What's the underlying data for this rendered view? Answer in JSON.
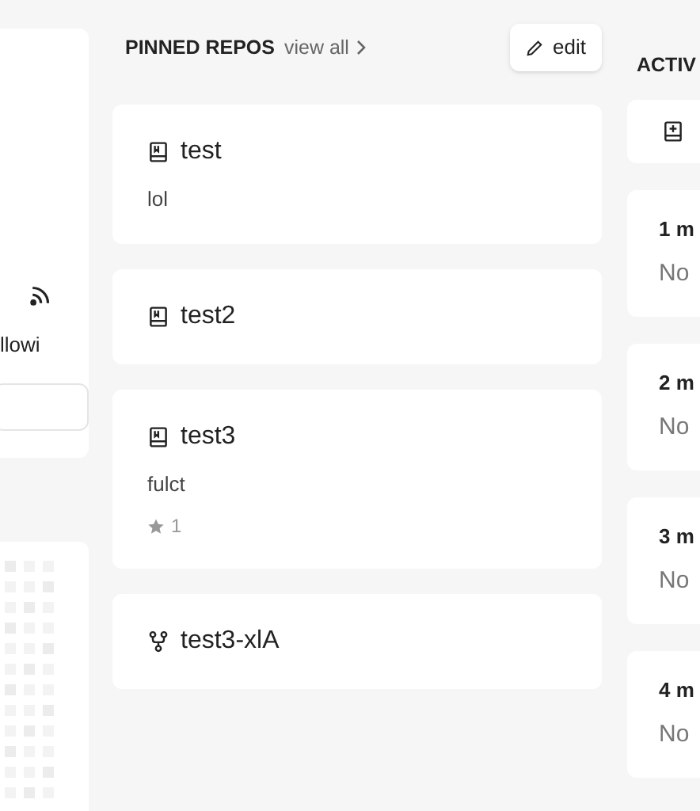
{
  "profile_card": {
    "following_label": "llowi"
  },
  "pinned": {
    "title": "PINNED REPOS",
    "view_all": "view all",
    "edit": "edit",
    "repos": [
      {
        "kind": "repo",
        "name": "test",
        "description": "lol"
      },
      {
        "kind": "repo",
        "name": "test2"
      },
      {
        "kind": "repo",
        "name": "test3",
        "description": "fulct",
        "stars": "1"
      },
      {
        "kind": "fork",
        "name": "test3-xlA"
      }
    ]
  },
  "activity": {
    "title": "ACTIV",
    "items": [
      {
        "kind": "new"
      },
      {
        "kind": "month",
        "label": "1 m",
        "text": "No"
      },
      {
        "kind": "month",
        "label": "2 m",
        "text": "No"
      },
      {
        "kind": "month",
        "label": "3 m",
        "text": "No"
      },
      {
        "kind": "month",
        "label": "4 m",
        "text": "No"
      }
    ]
  }
}
